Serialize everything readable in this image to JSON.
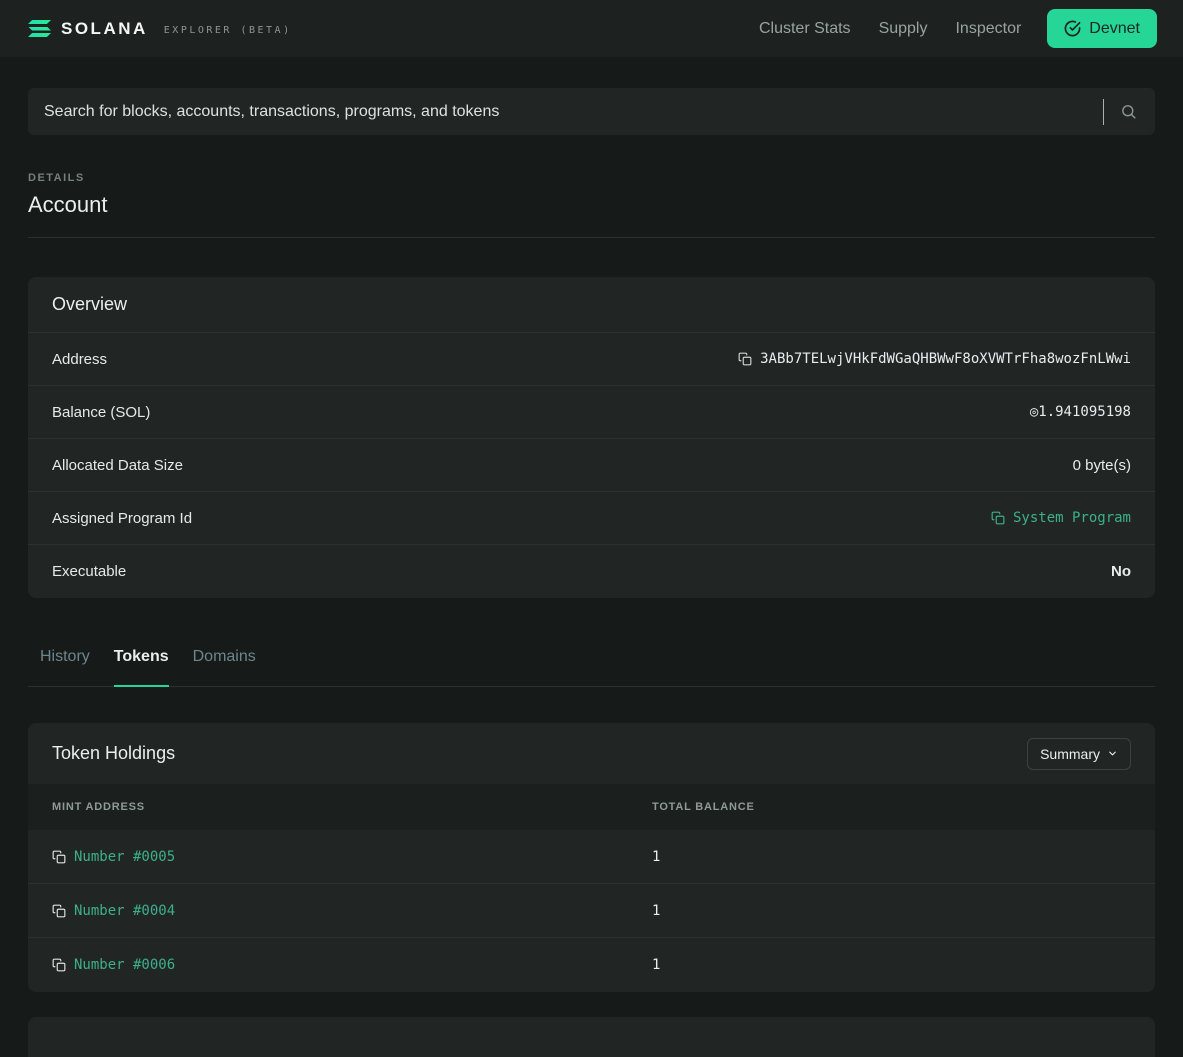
{
  "navbar": {
    "brand": "SOLANA",
    "brand_suffix": "EXPLORER (BETA)",
    "links": [
      {
        "label": "Cluster Stats"
      },
      {
        "label": "Supply"
      },
      {
        "label": "Inspector"
      }
    ],
    "cluster_button": {
      "label": "Devnet",
      "icon": "check-circle-icon"
    }
  },
  "search": {
    "placeholder": "Search for blocks, accounts, transactions, programs, and tokens",
    "icon": "search-icon"
  },
  "page_header": {
    "eyebrow": "DETAILS",
    "title": "Account"
  },
  "overview": {
    "title": "Overview",
    "rows": [
      {
        "label": "Address",
        "value": "3ABb7TELwjVHkFdWGaQHBWwF8oXVWTrFha8wozFnLWwi",
        "copyable": true
      },
      {
        "label": "Balance (SOL)",
        "value": "◎1.941095198",
        "copyable": false
      },
      {
        "label": "Allocated Data Size",
        "value": "0 byte(s)",
        "copyable": false
      },
      {
        "label": "Assigned Program Id",
        "value": "System Program",
        "copyable": true,
        "is_link": true
      },
      {
        "label": "Executable",
        "value": "No",
        "copyable": false
      }
    ]
  },
  "tabs": [
    {
      "label": "History",
      "active": false
    },
    {
      "label": "Tokens",
      "active": true
    },
    {
      "label": "Domains",
      "active": false
    }
  ],
  "token_holdings": {
    "title": "Token Holdings",
    "display_mode_button": {
      "label": "Summary",
      "icon": "chevron-down-icon"
    },
    "columns": [
      "MINT ADDRESS",
      "TOTAL BALANCE"
    ],
    "rows": [
      {
        "mint": "Number #0005",
        "balance": "1"
      },
      {
        "mint": "Number #0004",
        "balance": "1"
      },
      {
        "mint": "Number #0006",
        "balance": "1"
      }
    ]
  },
  "colors": {
    "page_background": "#161b1a",
    "navbar_background": "#1d2221",
    "card_background": "#212625",
    "table_head_background": "#1b201f",
    "divider": "#2b3130",
    "accent_green": "#26d696",
    "link_green": "#3cb08a",
    "muted_text": "#8f9a97",
    "inactive_tab": "#6d858c"
  }
}
